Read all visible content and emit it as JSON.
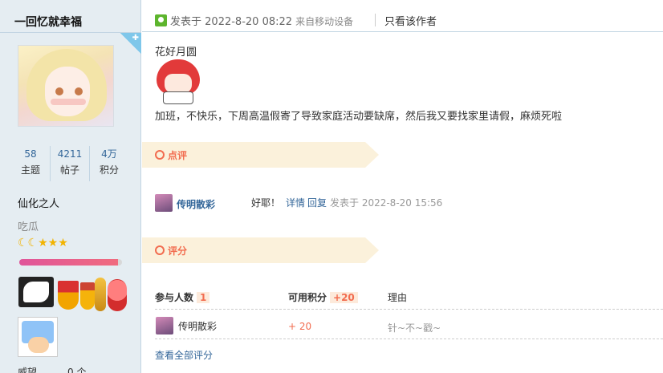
{
  "author": {
    "name": "一回忆就幸福",
    "stats": [
      {
        "value": "58",
        "label": "主题"
      },
      {
        "value": "4211",
        "label": "帖子"
      },
      {
        "value": "4万",
        "label": "积分"
      }
    ],
    "group_title": "仙化之人",
    "custom_title": "吃瓜",
    "bottom_label": "威望",
    "bottom_value": "0 个"
  },
  "post": {
    "posted_prefix": "发表于",
    "posted_time": "2022-8-20 08:22",
    "device": "来自移动设备",
    "only_author": "只看该作者",
    "title": "花好月圆",
    "body": "加班，不快乐，下周高温假寄了导致家庭活动要缺席，然后我又要找家里请假，麻烦死啦"
  },
  "comments_section": {
    "label": "点评",
    "items": [
      {
        "user": "传明散彩",
        "text": "好耶！",
        "detail_link": "详情",
        "reply_link": "回复",
        "time": "发表于 2022-8-20 15:56"
      }
    ]
  },
  "rating_section": {
    "label": "评分",
    "headers": {
      "participants": "参与人数",
      "participants_count": "1",
      "points": "可用积分",
      "points_total": "+20",
      "reason": "理由"
    },
    "rows": [
      {
        "user": "传明散彩",
        "score": "+ 20",
        "reason": "针~不~戳~"
      }
    ],
    "view_all": "查看全部评分"
  }
}
